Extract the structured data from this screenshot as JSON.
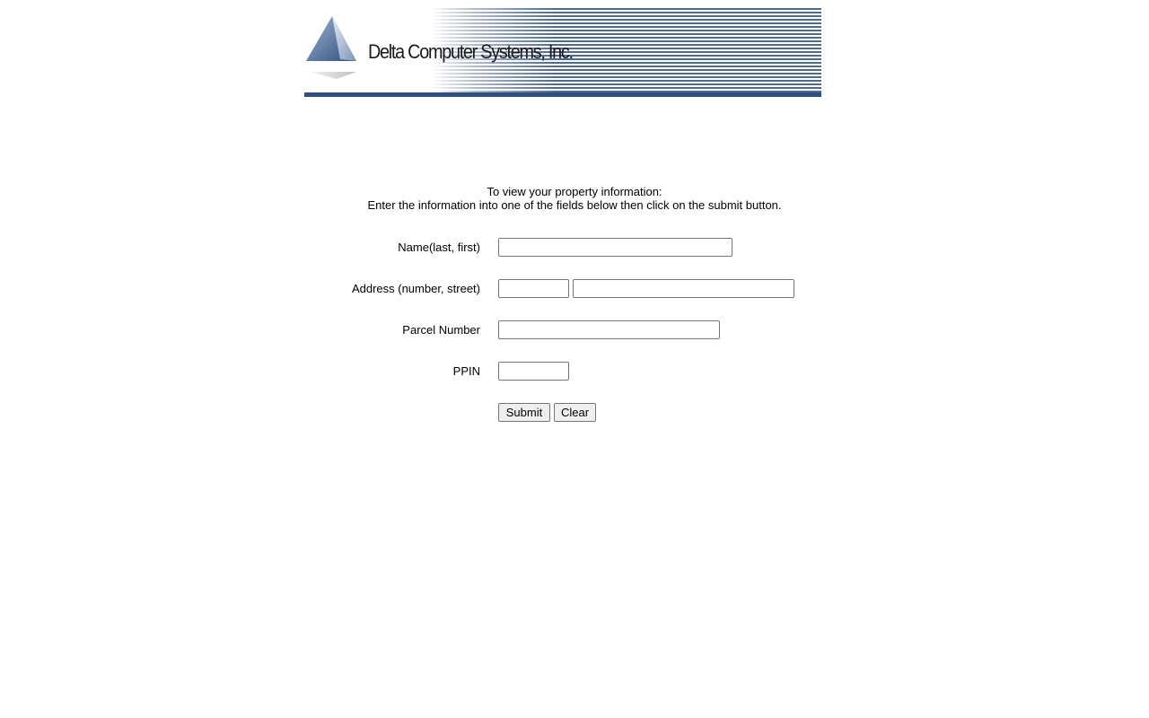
{
  "header": {
    "brand_name": "Delta Computer Systems, Inc."
  },
  "intro": {
    "line1": "To view your property information:",
    "line2": "Enter the information into one of the fields below then click on the submit button."
  },
  "form": {
    "name_label": "Name(last, first)",
    "name_value": "",
    "address_label": "Address (number, street)",
    "address_number_value": "",
    "address_street_value": "",
    "parcel_label": "Parcel Number",
    "parcel_value": "",
    "ppin_label": "PPIN",
    "ppin_value": "",
    "submit_label": "Submit",
    "clear_label": "Clear"
  },
  "colors": {
    "brand_blue": "#2f4f7f",
    "logo_light": "#c9d4e3"
  }
}
